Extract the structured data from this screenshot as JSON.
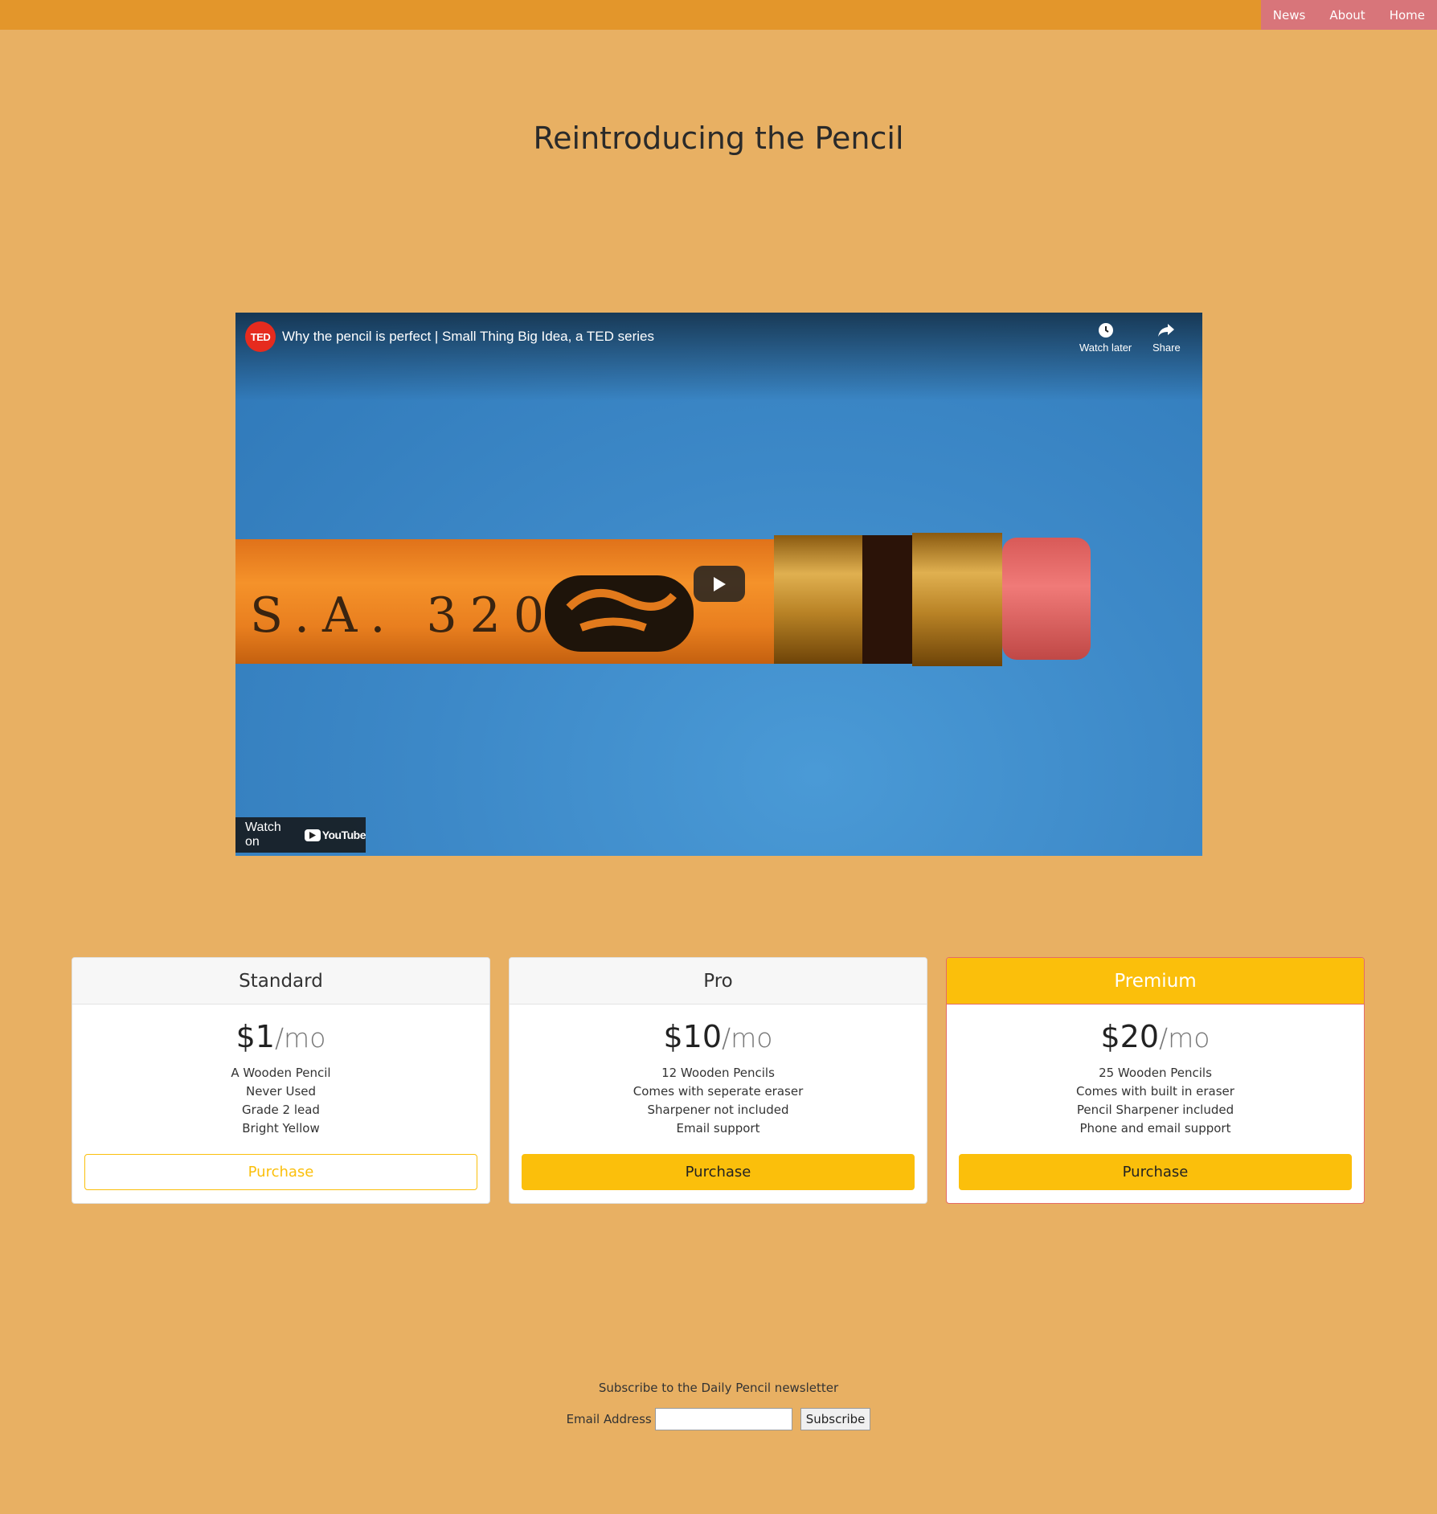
{
  "nav": {
    "items": [
      {
        "label": "News"
      },
      {
        "label": "About"
      },
      {
        "label": "Home"
      }
    ]
  },
  "page_title": "Reintroducing the Pencil",
  "video": {
    "channel_logo_text": "TED",
    "title": "Why the pencil is perfect | Small Thing Big Idea, a TED series",
    "watch_later_label": "Watch later",
    "share_label": "Share",
    "watch_on_label": "Watch on",
    "youtube_label": "YouTube",
    "pencil_text": "S.A. 320"
  },
  "plans": [
    {
      "name": "Standard",
      "price": "$1",
      "period": "/mo",
      "features": [
        "A Wooden Pencil",
        "Never Used",
        "Grade 2 lead",
        "Bright Yellow"
      ],
      "button_label": "Purchase"
    },
    {
      "name": "Pro",
      "price": "$10",
      "period": "/mo",
      "features": [
        "12 Wooden Pencils",
        "Comes with seperate eraser",
        "Sharpener not included",
        "Email support"
      ],
      "button_label": "Purchase"
    },
    {
      "name": "Premium",
      "price": "$20",
      "period": "/mo",
      "features": [
        "25 Wooden Pencils",
        "Comes with built in eraser",
        "Pencil Sharpener included",
        "Phone and email support"
      ],
      "button_label": "Purchase"
    }
  ],
  "newsletter": {
    "title": "Subscribe to the Daily Pencil newsletter",
    "email_label": "Email Address",
    "email_value": "",
    "subscribe_label": "Subscribe"
  },
  "colors": {
    "page_background": "#e8b063",
    "topbar": "#e3962b",
    "nav_background": "#d8757a",
    "accent_yellow": "#fbbf0b",
    "premium_border": "#e46b66"
  }
}
